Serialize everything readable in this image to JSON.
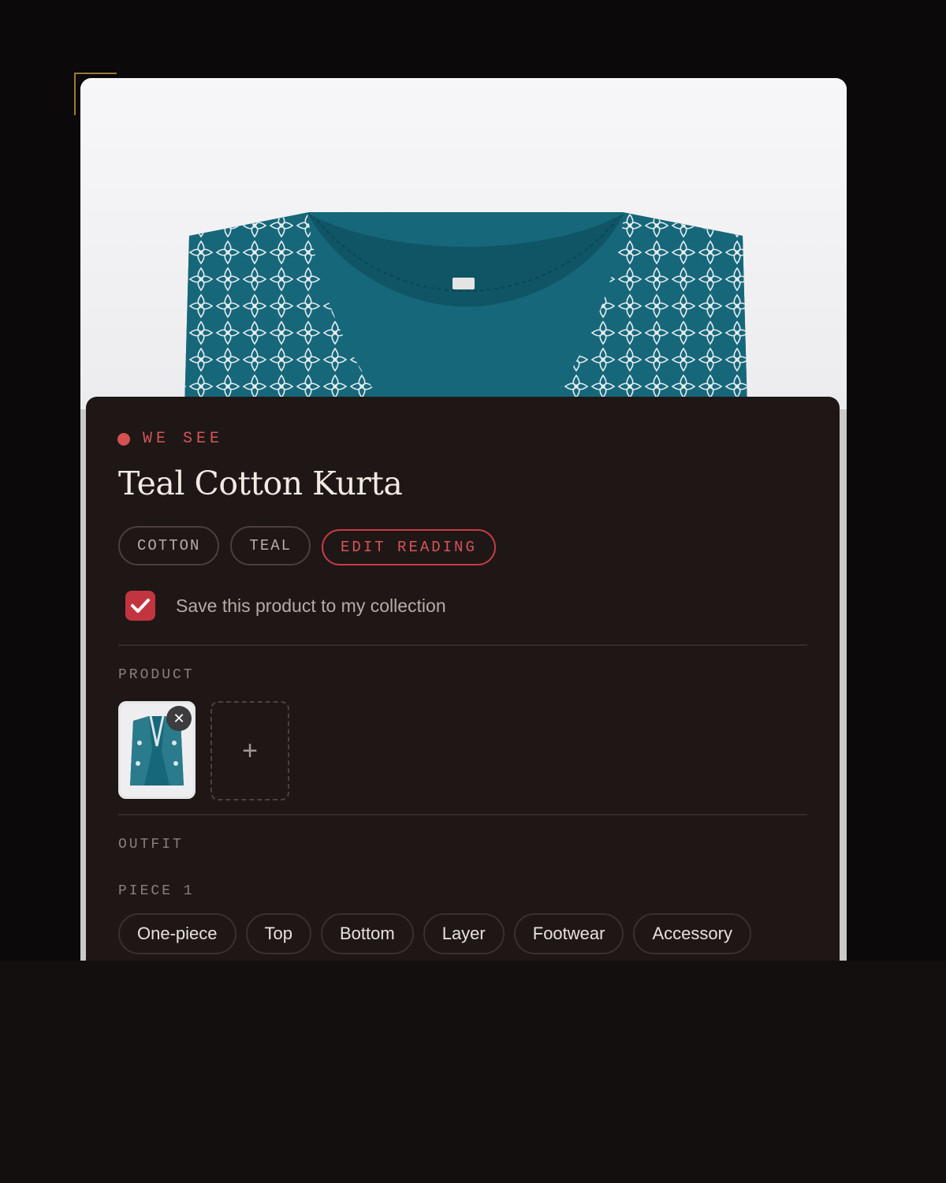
{
  "status": {
    "eyebrow": "WE SEE"
  },
  "product": {
    "title": "Teal Cotton Kurta",
    "tags": [
      "COTTON",
      "TEAL"
    ],
    "edit_label": "EDIT READING",
    "save_label": "Save this product to my collection",
    "save_checked": true
  },
  "sections": {
    "product_label": "PRODUCT",
    "outfit_label": "OUTFIT",
    "piece_label": "PIECE 1",
    "add_symbol": "+",
    "remove_symbol": "✕"
  },
  "piece_types": [
    "One-piece",
    "Top",
    "Bottom",
    "Layer",
    "Footwear",
    "Accessory"
  ],
  "colors": {
    "accent": "#c23440",
    "garment": "#16677a",
    "sheet_bg": "#1e1716"
  },
  "icons": {
    "checkbox": "check-icon",
    "remove": "close-icon",
    "add": "plus-icon"
  }
}
